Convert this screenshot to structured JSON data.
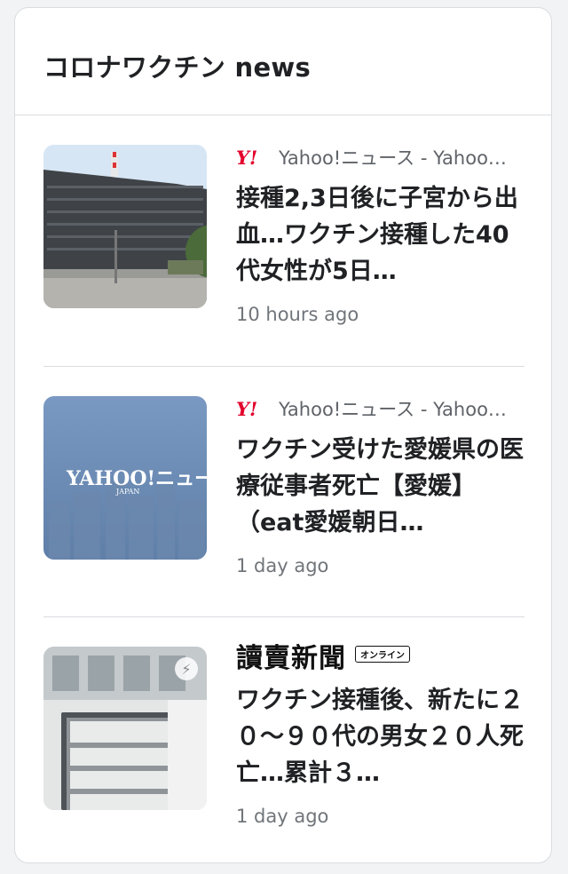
{
  "widget": {
    "title": "コロナワクチン news"
  },
  "colors": {
    "yahoo_red": "#e3002c",
    "divider": "#dadce0",
    "meta_gray": "#70757a"
  },
  "articles": [
    {
      "thumbnail": "government-building-photo",
      "source_logo": "Y!",
      "source": "Yahoo!ニュース - Yahoo…",
      "headline": "接種2,3日後に子宮から出血…ワクチン接種した40代女性が5日…",
      "time": "10 hours ago"
    },
    {
      "thumbnail": "yahoo-news-japan-logo-image",
      "source_logo": "Y!",
      "source": "Yahoo!ニュース - Yahoo…",
      "thumb_text": "YAHOO!ニュース",
      "thumb_subtext": "JAPAN",
      "headline": "ワクチン受けた愛媛県の医療従事者死亡【愛媛】（eat愛媛朝日…",
      "time": "1 day ago"
    },
    {
      "thumbnail": "ministry-building-sign-photo",
      "source_logo": "讀賣新聞",
      "source_badge": "オンライン",
      "headline": "ワクチン接種後、新たに２０～９０代の男女２０人死亡…累計３…",
      "time": "1 day ago",
      "amp_icon": "lightning-icon"
    }
  ]
}
